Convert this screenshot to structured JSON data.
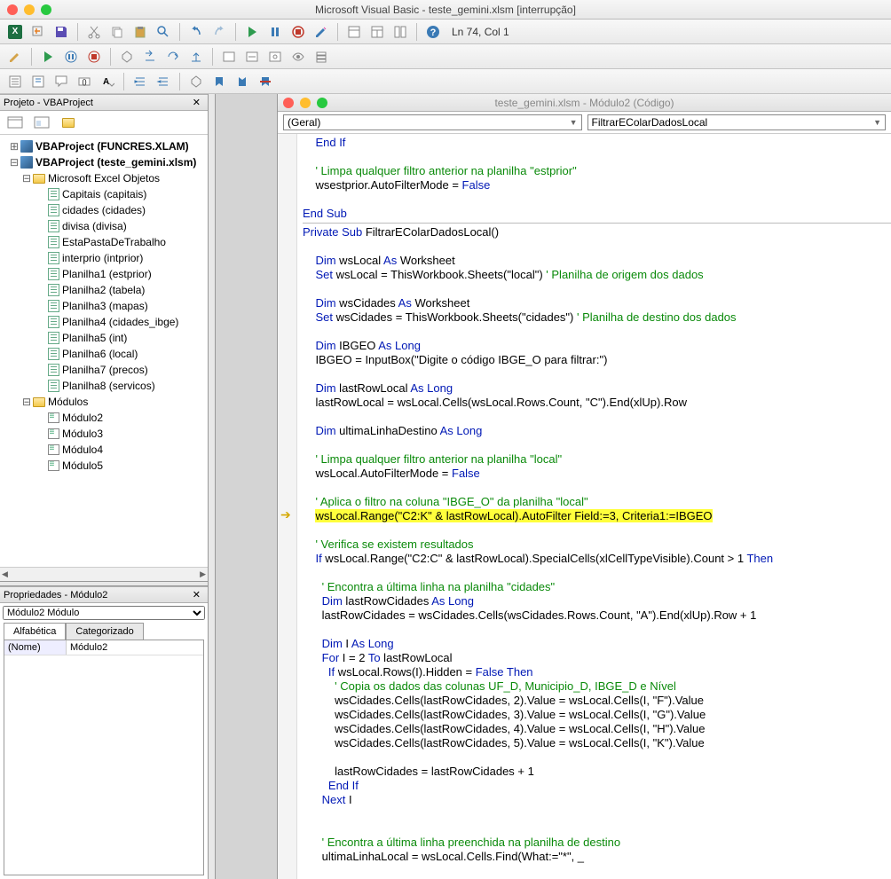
{
  "window": {
    "title": "Microsoft Visual Basic - teste_gemini.xlsm [interrupção]"
  },
  "status": {
    "cursor": "Ln 74, Col 1"
  },
  "project_panel": {
    "title": "Projeto - VBAProject",
    "roots": [
      {
        "label": "VBAProject (FUNCRES.XLAM)",
        "expanded": false
      },
      {
        "label": "VBAProject (teste_gemini.xlsm)",
        "expanded": true
      }
    ],
    "excel_objects_label": "Microsoft Excel Objetos",
    "sheets": [
      "Capitais (capitais)",
      "cidades (cidades)",
      "divisa (divisa)",
      "EstaPastaDeTrabalho",
      "interprio (intprior)",
      "Planilha1 (estprior)",
      "Planilha2 (tabela)",
      "Planilha3 (mapas)",
      "Planilha4 (cidades_ibge)",
      "Planilha5 (int)",
      "Planilha6 (local)",
      "Planilha7 (precos)",
      "Planilha8 (servicos)"
    ],
    "modules_label": "Módulos",
    "modules": [
      "Módulo2",
      "Módulo3",
      "Módulo4",
      "Módulo5"
    ]
  },
  "properties_panel": {
    "title": "Propriedades - Módulo2",
    "combo": "Módulo2 Módulo",
    "tab_alpha": "Alfabética",
    "tab_cat": "Categorizado",
    "rows": [
      {
        "name": "(Nome)",
        "value": "Módulo2"
      }
    ]
  },
  "code_window": {
    "title": "teste_gemini.xlsm - Módulo2 (Código)",
    "left_dd": "(Geral)",
    "right_dd": "FiltrarEColarDadosLocal",
    "lines": [
      {
        "t": "    <kw>End If</kw>"
      },
      {
        "t": "    "
      },
      {
        "t": "    <cm>' Limpa qualquer filtro anterior na planilha \"estprior\"</cm>"
      },
      {
        "t": "    wsestprior.AutoFilterMode = <kw>False</kw>"
      },
      {
        "t": "    "
      },
      {
        "t": "<kw>End Sub</kw>"
      },
      {
        "sep": true
      },
      {
        "t": "<kw>Private Sub</kw> FiltrarEColarDadosLocal()"
      },
      {
        "t": ""
      },
      {
        "t": "    <kw>Dim</kw> wsLocal <kw>As</kw> Worksheet"
      },
      {
        "t": "    <kw>Set</kw> wsLocal = ThisWorkbook.Sheets(\"local\") <cm>' Planilha de origem dos dados</cm>"
      },
      {
        "t": ""
      },
      {
        "t": "    <kw>Dim</kw> wsCidades <kw>As</kw> Worksheet"
      },
      {
        "t": "    <kw>Set</kw> wsCidades = ThisWorkbook.Sheets(\"cidades\") <cm>' Planilha de destino dos dados</cm>"
      },
      {
        "t": ""
      },
      {
        "t": "    <kw>Dim</kw> IBGEO <kw>As Long</kw>"
      },
      {
        "t": "    IBGEO = InputBox(\"Digite o código IBGE_O para filtrar:\")"
      },
      {
        "t": ""
      },
      {
        "t": "    <kw>Dim</kw> lastRowLocal <kw>As Long</kw>"
      },
      {
        "t": "    lastRowLocal = wsLocal.Cells(wsLocal.Rows.Count, \"C\").End(xlUp).Row"
      },
      {
        "t": ""
      },
      {
        "t": "    <kw>Dim</kw> ultimaLinhaDestino <kw>As Long</kw>"
      },
      {
        "t": ""
      },
      {
        "t": "    <cm>' Limpa qualquer filtro anterior na planilha \"local\"</cm>"
      },
      {
        "t": "    wsLocal.AutoFilterMode = <kw>False</kw>"
      },
      {
        "t": ""
      },
      {
        "t": "    <cm>' Aplica o filtro na coluna \"IBGE_O\" da planilha \"local\"</cm>"
      },
      {
        "t": "    <hl>wsLocal.Range(\"C2:K\" & lastRowLocal).AutoFilter Field:=3, Criteria1:=IBGEO</hl>",
        "break": true
      },
      {
        "t": ""
      },
      {
        "t": "    <cm>' Verifica se existem resultados</cm>"
      },
      {
        "t": "    <kw>If</kw> wsLocal.Range(\"C2:C\" & lastRowLocal).SpecialCells(xlCellTypeVisible).Count > 1 <kw>Then</kw>"
      },
      {
        "t": ""
      },
      {
        "t": "      <cm>' Encontra a última linha na planilha \"cidades\"</cm>"
      },
      {
        "t": "      <kw>Dim</kw> lastRowCidades <kw>As Long</kw>"
      },
      {
        "t": "      lastRowCidades = wsCidades.Cells(wsCidades.Rows.Count, \"A\").End(xlUp).Row + 1"
      },
      {
        "t": ""
      },
      {
        "t": "      <kw>Dim</kw> I <kw>As Long</kw>"
      },
      {
        "t": "      <kw>For</kw> I = 2 <kw>To</kw> lastRowLocal"
      },
      {
        "t": "        <kw>If</kw> wsLocal.Rows(I).Hidden = <kw>False Then</kw>"
      },
      {
        "t": "          <cm>' Copia os dados das colunas UF_D, Municipio_D, IBGE_D e Nível</cm>"
      },
      {
        "t": "          wsCidades.Cells(lastRowCidades, 2).Value = wsLocal.Cells(I, \"F\").Value"
      },
      {
        "t": "          wsCidades.Cells(lastRowCidades, 3).Value = wsLocal.Cells(I, \"G\").Value"
      },
      {
        "t": "          wsCidades.Cells(lastRowCidades, 4).Value = wsLocal.Cells(I, \"H\").Value"
      },
      {
        "t": "          wsCidades.Cells(lastRowCidades, 5).Value = wsLocal.Cells(I, \"K\").Value"
      },
      {
        "t": ""
      },
      {
        "t": "          lastRowCidades = lastRowCidades + 1"
      },
      {
        "t": "        <kw>End If</kw>"
      },
      {
        "t": "      <kw>Next</kw> I"
      },
      {
        "t": ""
      },
      {
        "t": ""
      },
      {
        "t": "      <cm>' Encontra a última linha preenchida na planilha de destino</cm>"
      },
      {
        "t": "      ultimaLinhaLocal = wsLocal.Cells.Find(What:=\"*\", _"
      }
    ]
  }
}
